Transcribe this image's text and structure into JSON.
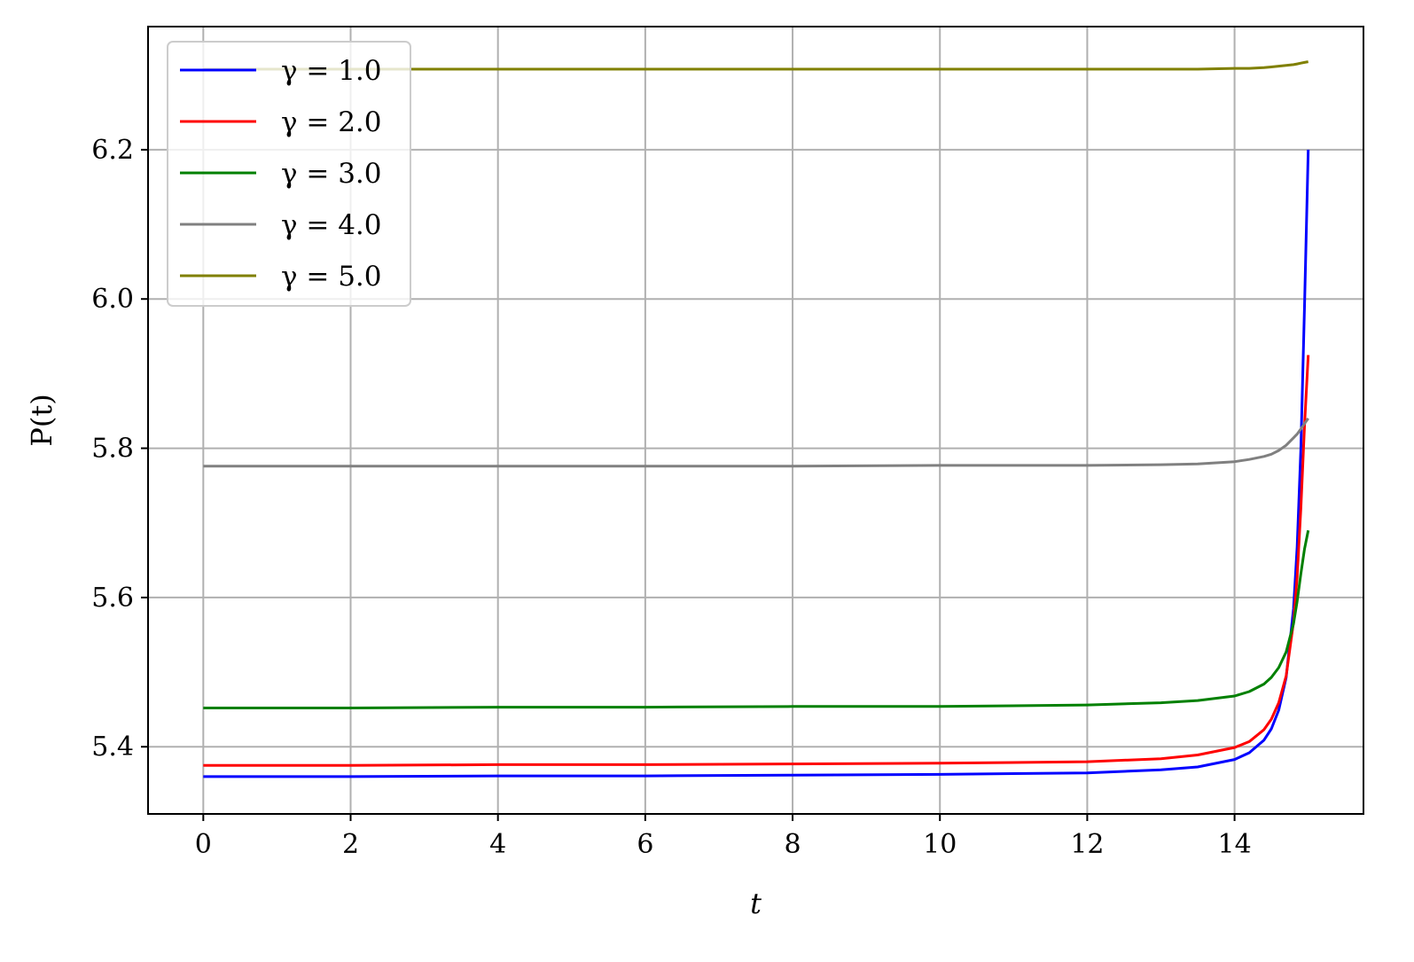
{
  "chart_data": {
    "type": "line",
    "xlabel": "t",
    "ylabel": "P(t)",
    "xlim": [
      -0.75,
      15.75
    ],
    "ylim": [
      5.31,
      6.365
    ],
    "xticks": [
      0,
      2,
      4,
      6,
      8,
      10,
      12,
      14
    ],
    "yticks": [
      5.4,
      5.6,
      5.8,
      6.0,
      6.2
    ],
    "xtick_labels": [
      "0",
      "2",
      "4",
      "6",
      "8",
      "10",
      "12",
      "14"
    ],
    "ytick_labels": [
      "5.4",
      "5.6",
      "5.8",
      "6.0",
      "6.2"
    ],
    "grid": true,
    "legend_position": "upper-left",
    "series": [
      {
        "name": "γ = 1.0",
        "color": "#0000ff",
        "x": [
          0,
          2,
          4,
          6,
          8,
          10,
          12,
          13,
          13.5,
          14,
          14.2,
          14.4,
          14.5,
          14.6,
          14.7,
          14.8,
          14.85,
          14.9,
          14.95,
          15.0
        ],
        "y": [
          5.36,
          5.36,
          5.361,
          5.361,
          5.362,
          5.363,
          5.365,
          5.369,
          5.373,
          5.383,
          5.392,
          5.409,
          5.424,
          5.449,
          5.493,
          5.585,
          5.668,
          5.8,
          5.99,
          6.2
        ]
      },
      {
        "name": "γ = 2.0",
        "color": "#ff0000",
        "x": [
          0,
          2,
          4,
          6,
          8,
          10,
          12,
          13,
          13.5,
          14,
          14.2,
          14.4,
          14.5,
          14.6,
          14.7,
          14.8,
          14.85,
          14.9,
          14.95,
          15.0
        ],
        "y": [
          5.375,
          5.375,
          5.376,
          5.376,
          5.377,
          5.378,
          5.38,
          5.384,
          5.389,
          5.399,
          5.407,
          5.423,
          5.437,
          5.459,
          5.495,
          5.567,
          5.628,
          5.72,
          5.83,
          5.925
        ]
      },
      {
        "name": "γ = 3.0",
        "color": "#008000",
        "x": [
          0,
          2,
          4,
          6,
          8,
          10,
          12,
          13,
          13.5,
          14,
          14.2,
          14.4,
          14.5,
          14.6,
          14.7,
          14.8,
          14.85,
          14.9,
          14.95,
          15.0
        ],
        "y": [
          5.452,
          5.452,
          5.453,
          5.453,
          5.454,
          5.454,
          5.456,
          5.459,
          5.462,
          5.468,
          5.474,
          5.484,
          5.493,
          5.506,
          5.527,
          5.565,
          5.595,
          5.632,
          5.665,
          5.69
        ]
      },
      {
        "name": "γ = 4.0",
        "color": "#808080",
        "x": [
          0,
          2,
          4,
          6,
          8,
          10,
          12,
          13,
          13.5,
          14,
          14.2,
          14.4,
          14.5,
          14.6,
          14.7,
          14.8,
          14.85,
          14.9,
          14.95,
          15.0
        ],
        "y": [
          5.776,
          5.776,
          5.776,
          5.776,
          5.776,
          5.777,
          5.777,
          5.778,
          5.779,
          5.782,
          5.785,
          5.789,
          5.792,
          5.797,
          5.804,
          5.814,
          5.819,
          5.826,
          5.833,
          5.84
        ]
      },
      {
        "name": "γ = 5.0",
        "color": "#808000",
        "x": [
          0,
          2,
          4,
          6,
          8,
          10,
          12,
          13,
          13.5,
          14,
          14.2,
          14.4,
          14.5,
          14.6,
          14.7,
          14.8,
          14.85,
          14.9,
          14.95,
          15.0
        ],
        "y": [
          6.308,
          6.308,
          6.308,
          6.308,
          6.308,
          6.308,
          6.308,
          6.308,
          6.308,
          6.309,
          6.309,
          6.31,
          6.311,
          6.312,
          6.313,
          6.314,
          6.315,
          6.316,
          6.317,
          6.318
        ]
      }
    ]
  }
}
